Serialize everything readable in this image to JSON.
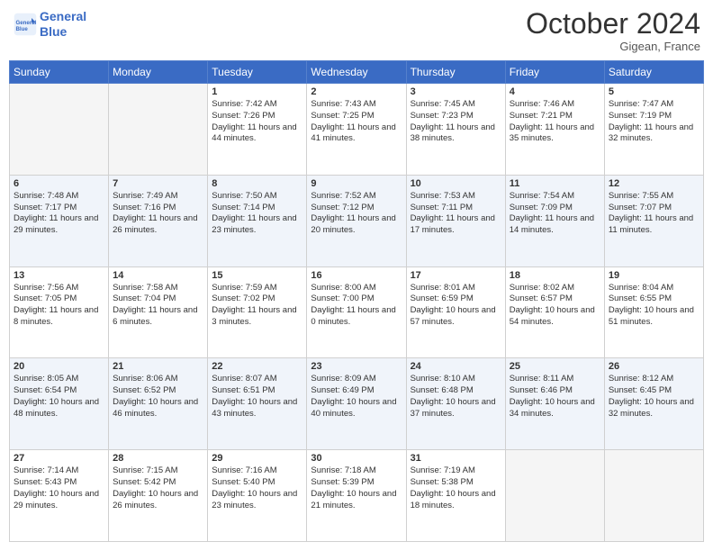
{
  "header": {
    "logo_line1": "General",
    "logo_line2": "Blue",
    "month": "October 2024",
    "location": "Gigean, France"
  },
  "days_of_week": [
    "Sunday",
    "Monday",
    "Tuesday",
    "Wednesday",
    "Thursday",
    "Friday",
    "Saturday"
  ],
  "weeks": [
    [
      {
        "day": "",
        "sunrise": "",
        "sunset": "",
        "daylight": ""
      },
      {
        "day": "",
        "sunrise": "",
        "sunset": "",
        "daylight": ""
      },
      {
        "day": "1",
        "sunrise": "Sunrise: 7:42 AM",
        "sunset": "Sunset: 7:26 PM",
        "daylight": "Daylight: 11 hours and 44 minutes."
      },
      {
        "day": "2",
        "sunrise": "Sunrise: 7:43 AM",
        "sunset": "Sunset: 7:25 PM",
        "daylight": "Daylight: 11 hours and 41 minutes."
      },
      {
        "day": "3",
        "sunrise": "Sunrise: 7:45 AM",
        "sunset": "Sunset: 7:23 PM",
        "daylight": "Daylight: 11 hours and 38 minutes."
      },
      {
        "day": "4",
        "sunrise": "Sunrise: 7:46 AM",
        "sunset": "Sunset: 7:21 PM",
        "daylight": "Daylight: 11 hours and 35 minutes."
      },
      {
        "day": "5",
        "sunrise": "Sunrise: 7:47 AM",
        "sunset": "Sunset: 7:19 PM",
        "daylight": "Daylight: 11 hours and 32 minutes."
      }
    ],
    [
      {
        "day": "6",
        "sunrise": "Sunrise: 7:48 AM",
        "sunset": "Sunset: 7:17 PM",
        "daylight": "Daylight: 11 hours and 29 minutes."
      },
      {
        "day": "7",
        "sunrise": "Sunrise: 7:49 AM",
        "sunset": "Sunset: 7:16 PM",
        "daylight": "Daylight: 11 hours and 26 minutes."
      },
      {
        "day": "8",
        "sunrise": "Sunrise: 7:50 AM",
        "sunset": "Sunset: 7:14 PM",
        "daylight": "Daylight: 11 hours and 23 minutes."
      },
      {
        "day": "9",
        "sunrise": "Sunrise: 7:52 AM",
        "sunset": "Sunset: 7:12 PM",
        "daylight": "Daylight: 11 hours and 20 minutes."
      },
      {
        "day": "10",
        "sunrise": "Sunrise: 7:53 AM",
        "sunset": "Sunset: 7:11 PM",
        "daylight": "Daylight: 11 hours and 17 minutes."
      },
      {
        "day": "11",
        "sunrise": "Sunrise: 7:54 AM",
        "sunset": "Sunset: 7:09 PM",
        "daylight": "Daylight: 11 hours and 14 minutes."
      },
      {
        "day": "12",
        "sunrise": "Sunrise: 7:55 AM",
        "sunset": "Sunset: 7:07 PM",
        "daylight": "Daylight: 11 hours and 11 minutes."
      }
    ],
    [
      {
        "day": "13",
        "sunrise": "Sunrise: 7:56 AM",
        "sunset": "Sunset: 7:05 PM",
        "daylight": "Daylight: 11 hours and 8 minutes."
      },
      {
        "day": "14",
        "sunrise": "Sunrise: 7:58 AM",
        "sunset": "Sunset: 7:04 PM",
        "daylight": "Daylight: 11 hours and 6 minutes."
      },
      {
        "day": "15",
        "sunrise": "Sunrise: 7:59 AM",
        "sunset": "Sunset: 7:02 PM",
        "daylight": "Daylight: 11 hours and 3 minutes."
      },
      {
        "day": "16",
        "sunrise": "Sunrise: 8:00 AM",
        "sunset": "Sunset: 7:00 PM",
        "daylight": "Daylight: 11 hours and 0 minutes."
      },
      {
        "day": "17",
        "sunrise": "Sunrise: 8:01 AM",
        "sunset": "Sunset: 6:59 PM",
        "daylight": "Daylight: 10 hours and 57 minutes."
      },
      {
        "day": "18",
        "sunrise": "Sunrise: 8:02 AM",
        "sunset": "Sunset: 6:57 PM",
        "daylight": "Daylight: 10 hours and 54 minutes."
      },
      {
        "day": "19",
        "sunrise": "Sunrise: 8:04 AM",
        "sunset": "Sunset: 6:55 PM",
        "daylight": "Daylight: 10 hours and 51 minutes."
      }
    ],
    [
      {
        "day": "20",
        "sunrise": "Sunrise: 8:05 AM",
        "sunset": "Sunset: 6:54 PM",
        "daylight": "Daylight: 10 hours and 48 minutes."
      },
      {
        "day": "21",
        "sunrise": "Sunrise: 8:06 AM",
        "sunset": "Sunset: 6:52 PM",
        "daylight": "Daylight: 10 hours and 46 minutes."
      },
      {
        "day": "22",
        "sunrise": "Sunrise: 8:07 AM",
        "sunset": "Sunset: 6:51 PM",
        "daylight": "Daylight: 10 hours and 43 minutes."
      },
      {
        "day": "23",
        "sunrise": "Sunrise: 8:09 AM",
        "sunset": "Sunset: 6:49 PM",
        "daylight": "Daylight: 10 hours and 40 minutes."
      },
      {
        "day": "24",
        "sunrise": "Sunrise: 8:10 AM",
        "sunset": "Sunset: 6:48 PM",
        "daylight": "Daylight: 10 hours and 37 minutes."
      },
      {
        "day": "25",
        "sunrise": "Sunrise: 8:11 AM",
        "sunset": "Sunset: 6:46 PM",
        "daylight": "Daylight: 10 hours and 34 minutes."
      },
      {
        "day": "26",
        "sunrise": "Sunrise: 8:12 AM",
        "sunset": "Sunset: 6:45 PM",
        "daylight": "Daylight: 10 hours and 32 minutes."
      }
    ],
    [
      {
        "day": "27",
        "sunrise": "Sunrise: 7:14 AM",
        "sunset": "Sunset: 5:43 PM",
        "daylight": "Daylight: 10 hours and 29 minutes."
      },
      {
        "day": "28",
        "sunrise": "Sunrise: 7:15 AM",
        "sunset": "Sunset: 5:42 PM",
        "daylight": "Daylight: 10 hours and 26 minutes."
      },
      {
        "day": "29",
        "sunrise": "Sunrise: 7:16 AM",
        "sunset": "Sunset: 5:40 PM",
        "daylight": "Daylight: 10 hours and 23 minutes."
      },
      {
        "day": "30",
        "sunrise": "Sunrise: 7:18 AM",
        "sunset": "Sunset: 5:39 PM",
        "daylight": "Daylight: 10 hours and 21 minutes."
      },
      {
        "day": "31",
        "sunrise": "Sunrise: 7:19 AM",
        "sunset": "Sunset: 5:38 PM",
        "daylight": "Daylight: 10 hours and 18 minutes."
      },
      {
        "day": "",
        "sunrise": "",
        "sunset": "",
        "daylight": ""
      },
      {
        "day": "",
        "sunrise": "",
        "sunset": "",
        "daylight": ""
      }
    ]
  ]
}
